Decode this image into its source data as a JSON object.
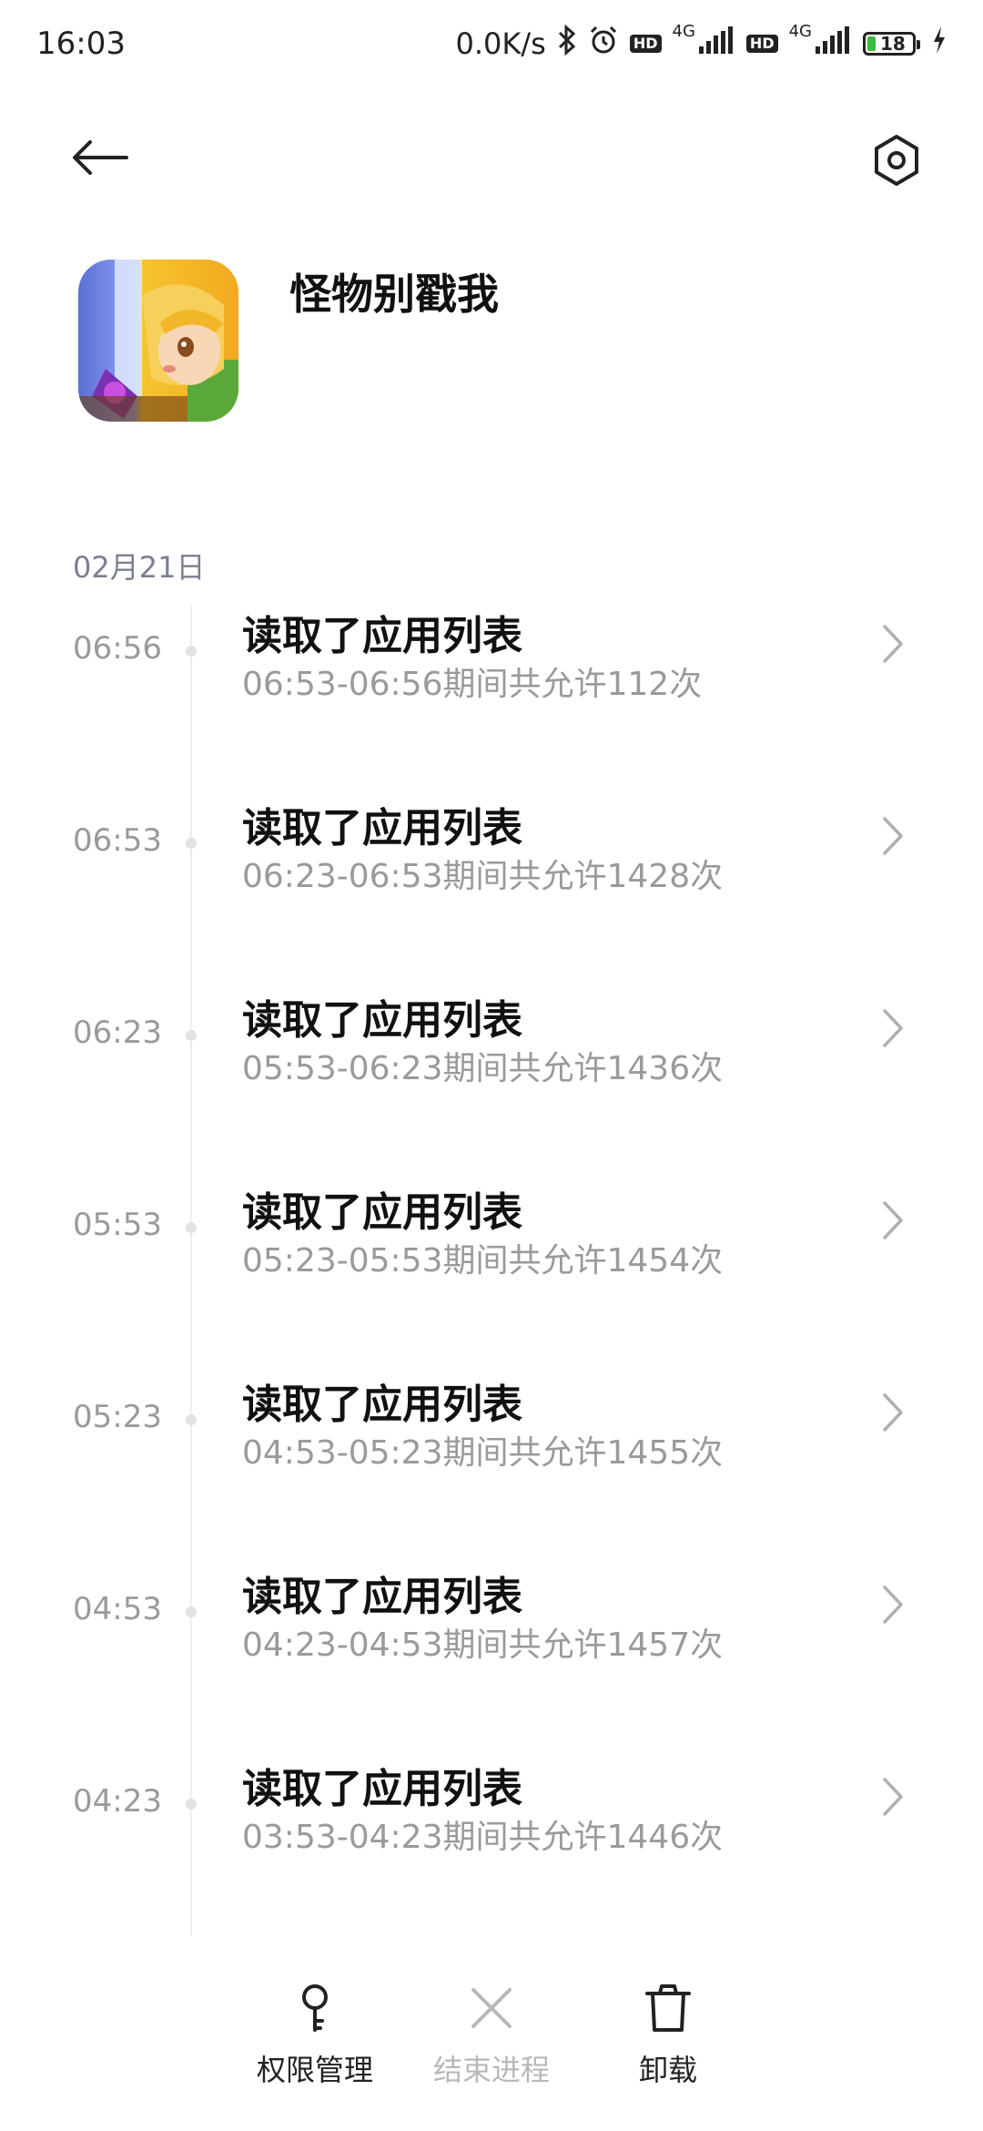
{
  "status_bar": {
    "time": "16:03",
    "network_speed": "0.0K/s",
    "hd_badge": "HD",
    "signal_label": "4G",
    "battery": "18",
    "icons": [
      "bluetooth-icon",
      "alarm-icon",
      "hd-icon",
      "signal-icon",
      "hd-icon",
      "signal-icon",
      "battery-icon",
      "charging-icon"
    ]
  },
  "top_bar": {
    "back_icon": "back-arrow-icon",
    "settings_icon": "settings-gear-icon"
  },
  "app": {
    "name": "怪物别戳我",
    "icon": "app-icon"
  },
  "timeline": {
    "date": "02月21日",
    "entries": [
      {
        "time": "06:56",
        "title": "读取了应用列表",
        "detail": "06:53-06:56期间共允许112次"
      },
      {
        "time": "06:53",
        "title": "读取了应用列表",
        "detail": "06:23-06:53期间共允许1428次"
      },
      {
        "time": "06:23",
        "title": "读取了应用列表",
        "detail": "05:53-06:23期间共允许1436次"
      },
      {
        "time": "05:53",
        "title": "读取了应用列表",
        "detail": "05:23-05:53期间共允许1454次"
      },
      {
        "time": "05:23",
        "title": "读取了应用列表",
        "detail": "04:53-05:23期间共允许1455次"
      },
      {
        "time": "04:53",
        "title": "读取了应用列表",
        "detail": "04:23-04:53期间共允许1457次"
      },
      {
        "time": "04:23",
        "title": "读取了应用列表",
        "detail": "03:53-04:23期间共允许1446次"
      }
    ]
  },
  "bottom_actions": {
    "permissions": {
      "label": "权限管理",
      "icon": "key-icon",
      "enabled": true
    },
    "end_process": {
      "label": "结束进程",
      "icon": "close-x-icon",
      "enabled": false
    },
    "uninstall": {
      "label": "卸载",
      "icon": "trash-icon",
      "enabled": true
    }
  },
  "colors": {
    "text_primary": "#111111",
    "text_secondary": "#9a9a9a",
    "date_label": "#7a8091",
    "disabled": "#b8b8b8"
  }
}
